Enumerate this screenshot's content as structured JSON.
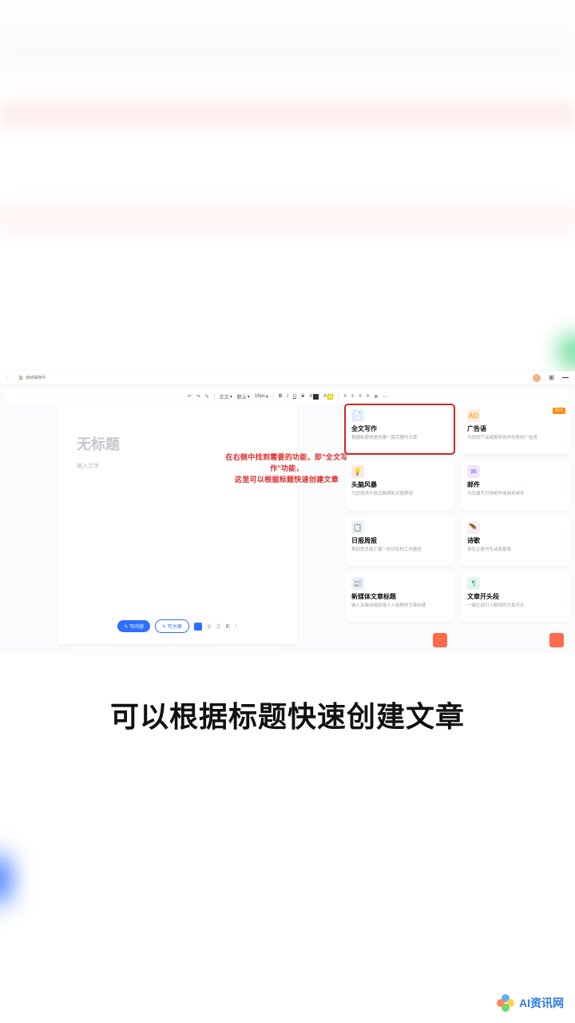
{
  "topbar": {
    "back": "←",
    "crumb_icon": "🏠",
    "crumb_text": "自动保存中"
  },
  "fmt": {
    "undo": "↶",
    "redo": "↷",
    "brush": "✎",
    "style_label": "正文",
    "font_label": "默认",
    "size_label": "16px",
    "bold": "B",
    "italic": "I",
    "underline": "U",
    "strike": "S",
    "color": "A",
    "hl": "A",
    "al1": "≡",
    "al2": "≡",
    "al3": "≡",
    "al4": "≡",
    "al5": "≣",
    "more": "⋯"
  },
  "doc": {
    "title_ph": "无标题",
    "body_ph": "输入文字",
    "btn1": "✎ 写内容",
    "btn2": "✎ 写大纲",
    "mini1": "全",
    "mini2": "文",
    "mini3": "◧",
    "next": "›"
  },
  "annot": {
    "line1": "在右侧中找到需要的功能，即\"全文写作\"功能，",
    "line2": "这里可以根据标题快速创建文章"
  },
  "cards": [
    {
      "title": "全文写作",
      "desc": "根据标题快速创建一篇完整的文章",
      "icon": "📄",
      "cls": "ic-blue",
      "hl": true
    },
    {
      "title": "广告语",
      "desc": "为您的产品或服务创作创意的广告语",
      "icon": "AD",
      "cls": "ic-orange",
      "badge": "ADS"
    },
    {
      "title": "头脑风暴",
      "desc": "为您提供开放式脑洞和灵感策划",
      "icon": "💡",
      "cls": "ic-red"
    },
    {
      "title": "邮件",
      "desc": "为您撰写日常邮件或商务邮件",
      "icon": "✉",
      "cls": "ic-purple"
    },
    {
      "title": "日报周报",
      "desc": "帮助您总结汇报一份详实的工作报告",
      "icon": "📋",
      "cls": "ic-cyan"
    },
    {
      "title": "诗歌",
      "desc": "按您主题书写诗意篇章",
      "icon": "🪶",
      "cls": "ic-gray"
    },
    {
      "title": "新媒体文章标题",
      "desc": "输入关键词或段落人人吸睛的文章标题",
      "icon": "📰",
      "cls": "ic-blue2"
    },
    {
      "title": "文章开头段",
      "desc": "一键生成引人眼球的文章开头",
      "icon": "¶",
      "cls": "ic-teal"
    }
  ],
  "caption": "可以根据标题快速创建文章",
  "watermark": "AI资讯网"
}
